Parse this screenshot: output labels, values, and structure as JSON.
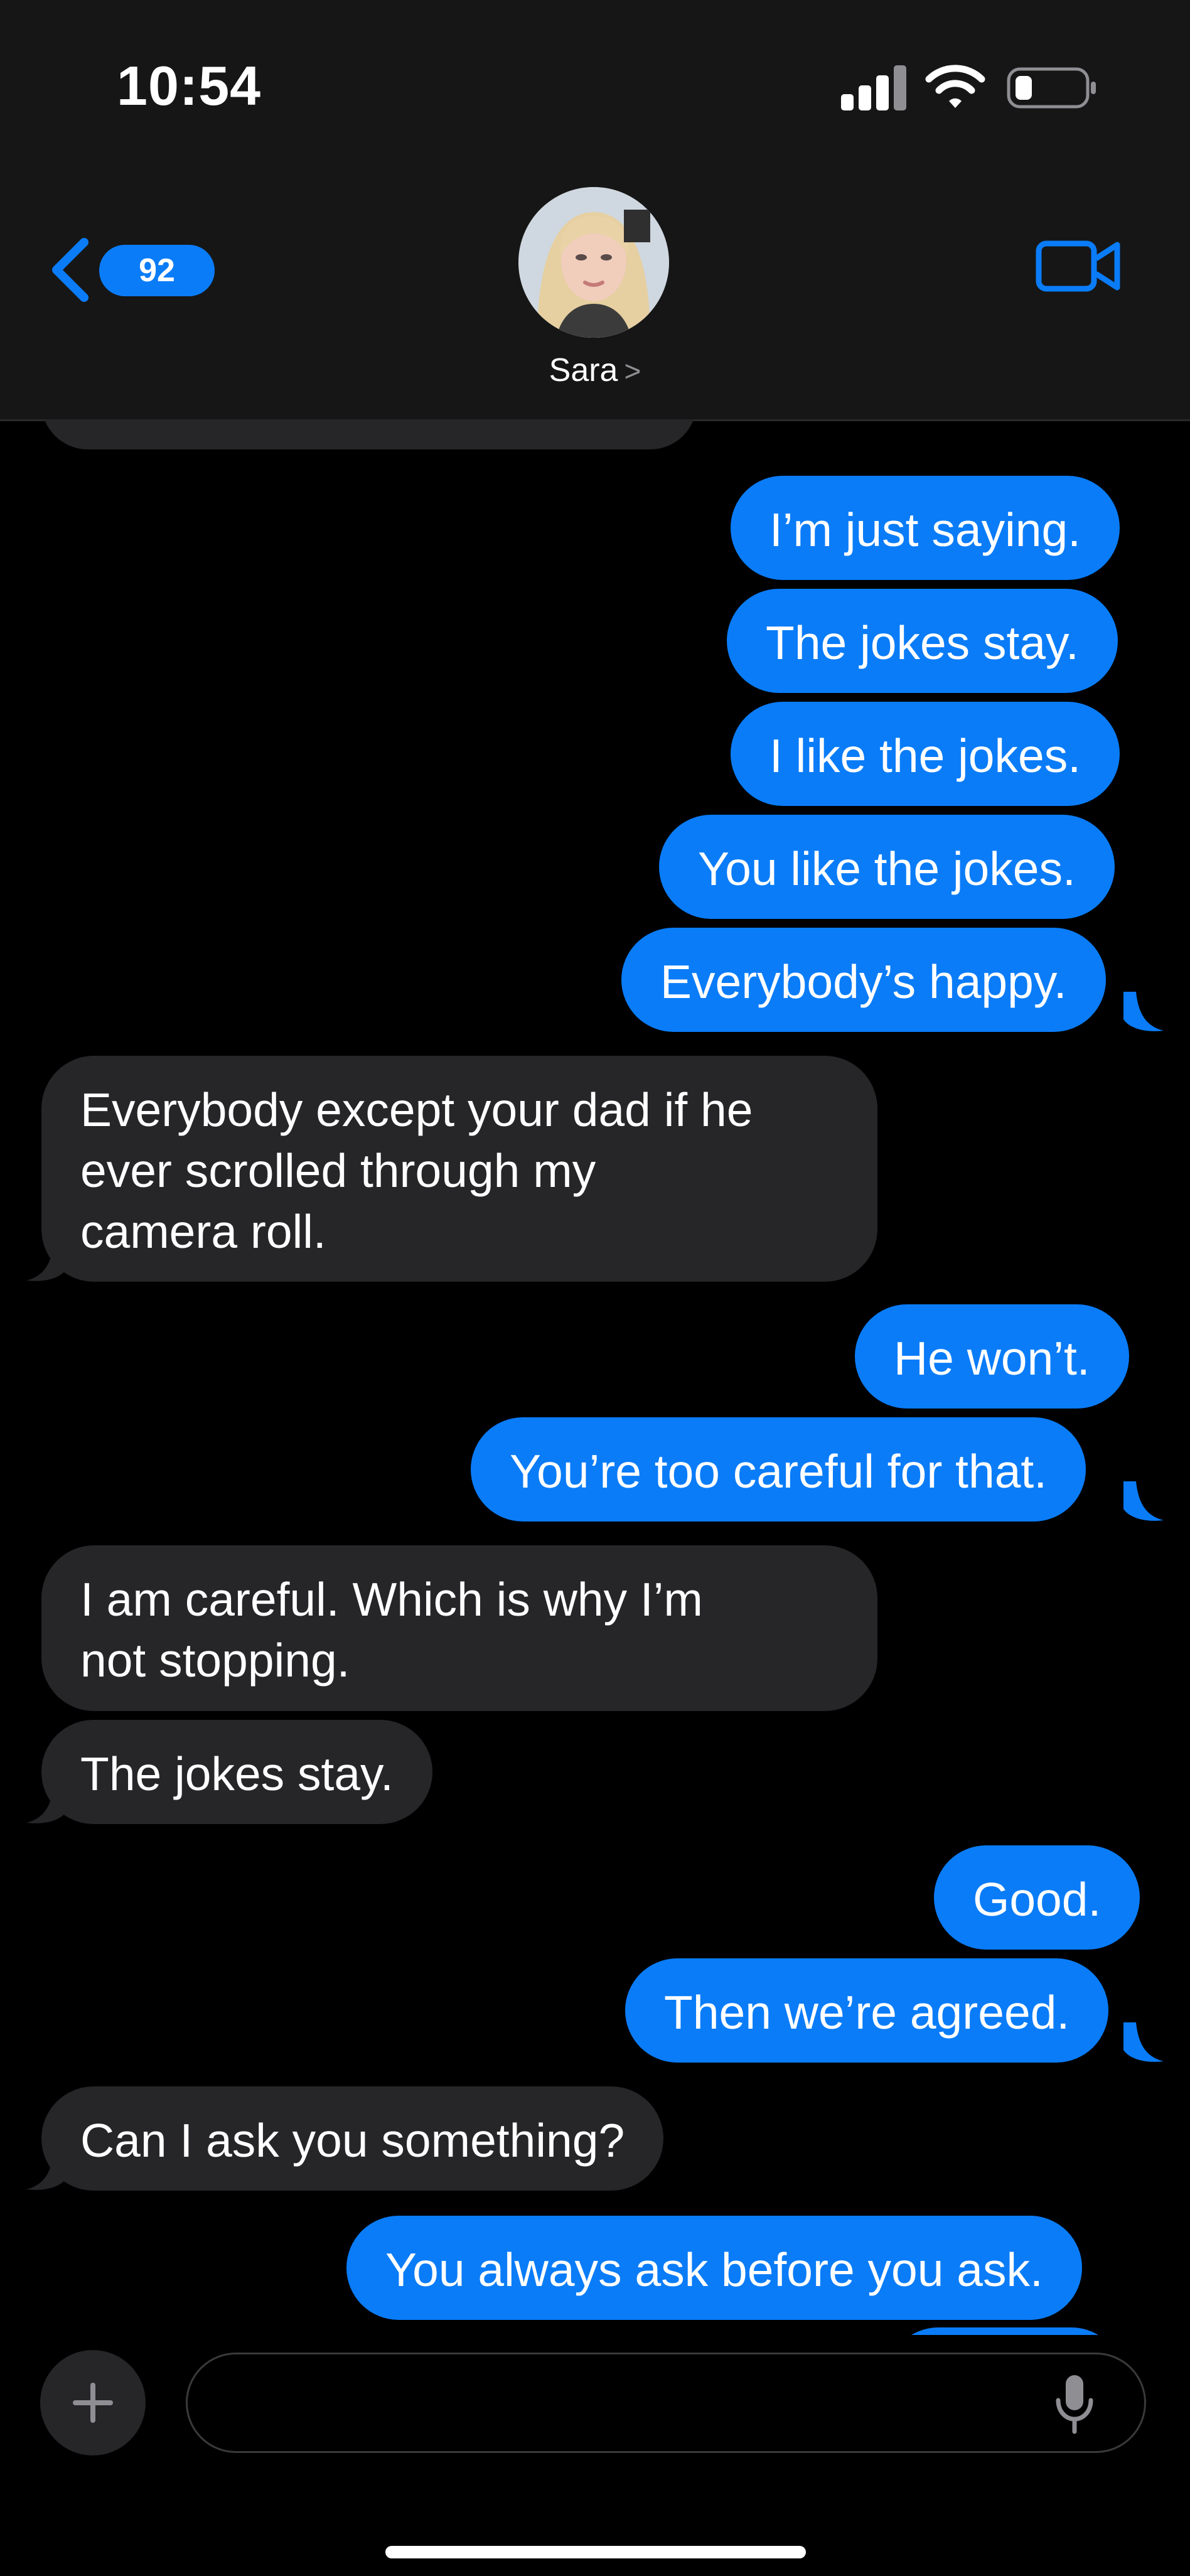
{
  "status_bar": {
    "time": "10:54"
  },
  "header": {
    "unread_count": "92",
    "contact_name": "Sara",
    "contact_chevron": ">"
  },
  "messages": [
    {
      "from": "me",
      "text": "I’m just saying."
    },
    {
      "from": "me",
      "text": "The jokes stay."
    },
    {
      "from": "me",
      "text": "I like the jokes."
    },
    {
      "from": "me",
      "text": "You like the jokes."
    },
    {
      "from": "me",
      "text": "Everybody’s happy."
    },
    {
      "from": "them",
      "lines": [
        "Everybody except your dad if he",
        "ever scrolled through my",
        "camera roll."
      ]
    },
    {
      "from": "me",
      "text": "He won’t."
    },
    {
      "from": "me",
      "text": "You’re too careful for that."
    },
    {
      "from": "them",
      "lines": [
        "I am careful. Which is why I’m",
        "not stopping."
      ]
    },
    {
      "from": "them",
      "text": "The jokes stay."
    },
    {
      "from": "me",
      "text": "Good."
    },
    {
      "from": "me",
      "text": "Then we’re agreed."
    },
    {
      "from": "them",
      "text": "Can I ask you something?"
    },
    {
      "from": "me",
      "text": "You always ask before you ask."
    }
  ],
  "composer": {
    "placeholder": ""
  },
  "colors": {
    "outgoing": "#0a7cf8",
    "incoming": "#262628",
    "background": "#000000"
  },
  "icons": [
    "back-chevron-icon",
    "video-camera-icon",
    "plus-icon",
    "microphone-icon",
    "signal-icon",
    "wifi-icon",
    "battery-icon"
  ]
}
